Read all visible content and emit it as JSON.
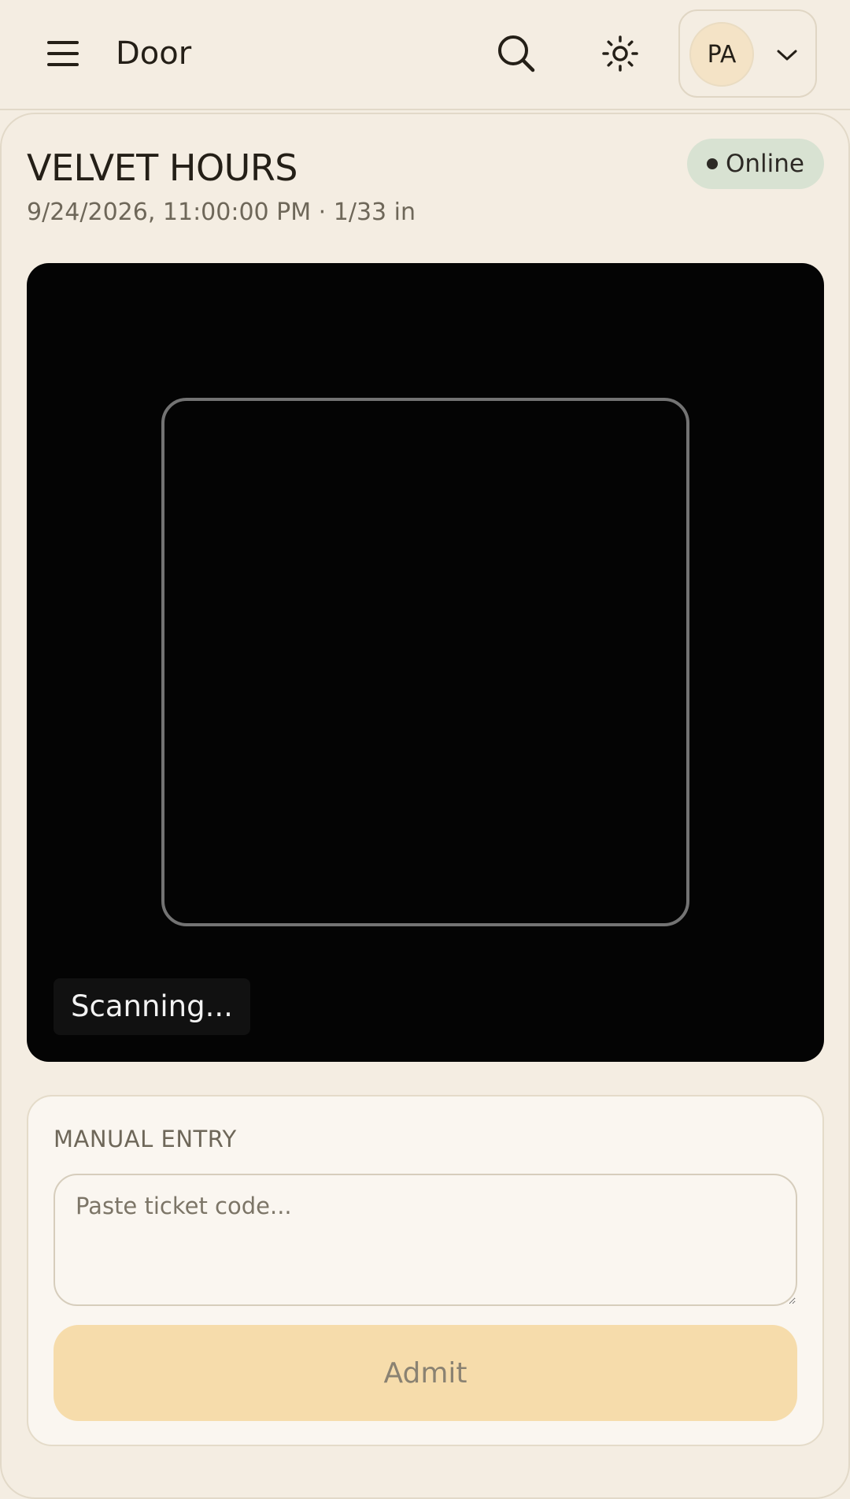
{
  "header": {
    "title": "Door",
    "menu_icon": "hamburger-menu-icon",
    "search_icon": "search-icon",
    "theme_icon": "sun-icon",
    "account": {
      "initials": "PA",
      "dropdown_icon": "chevron-down-icon"
    }
  },
  "event": {
    "name": "VELVET HOURS",
    "subtitle": "9/24/2026, 11:00:00 PM · 1/33 in",
    "status": "Online"
  },
  "scanner": {
    "status_text": "Scanning..."
  },
  "manual_entry": {
    "label": "MANUAL ENTRY",
    "input_placeholder": "Paste ticket code...",
    "input_value": "",
    "admit_label": "Admit",
    "admit_enabled": false
  },
  "colors": {
    "background": "#f4ede2",
    "text": "#241f17",
    "muted_text": "#6e6759",
    "online_badge": "#d8e2d2",
    "scanner_bg": "#040404",
    "admit_button": "#f6dcab",
    "avatar_bg": "#f4e3c6"
  }
}
